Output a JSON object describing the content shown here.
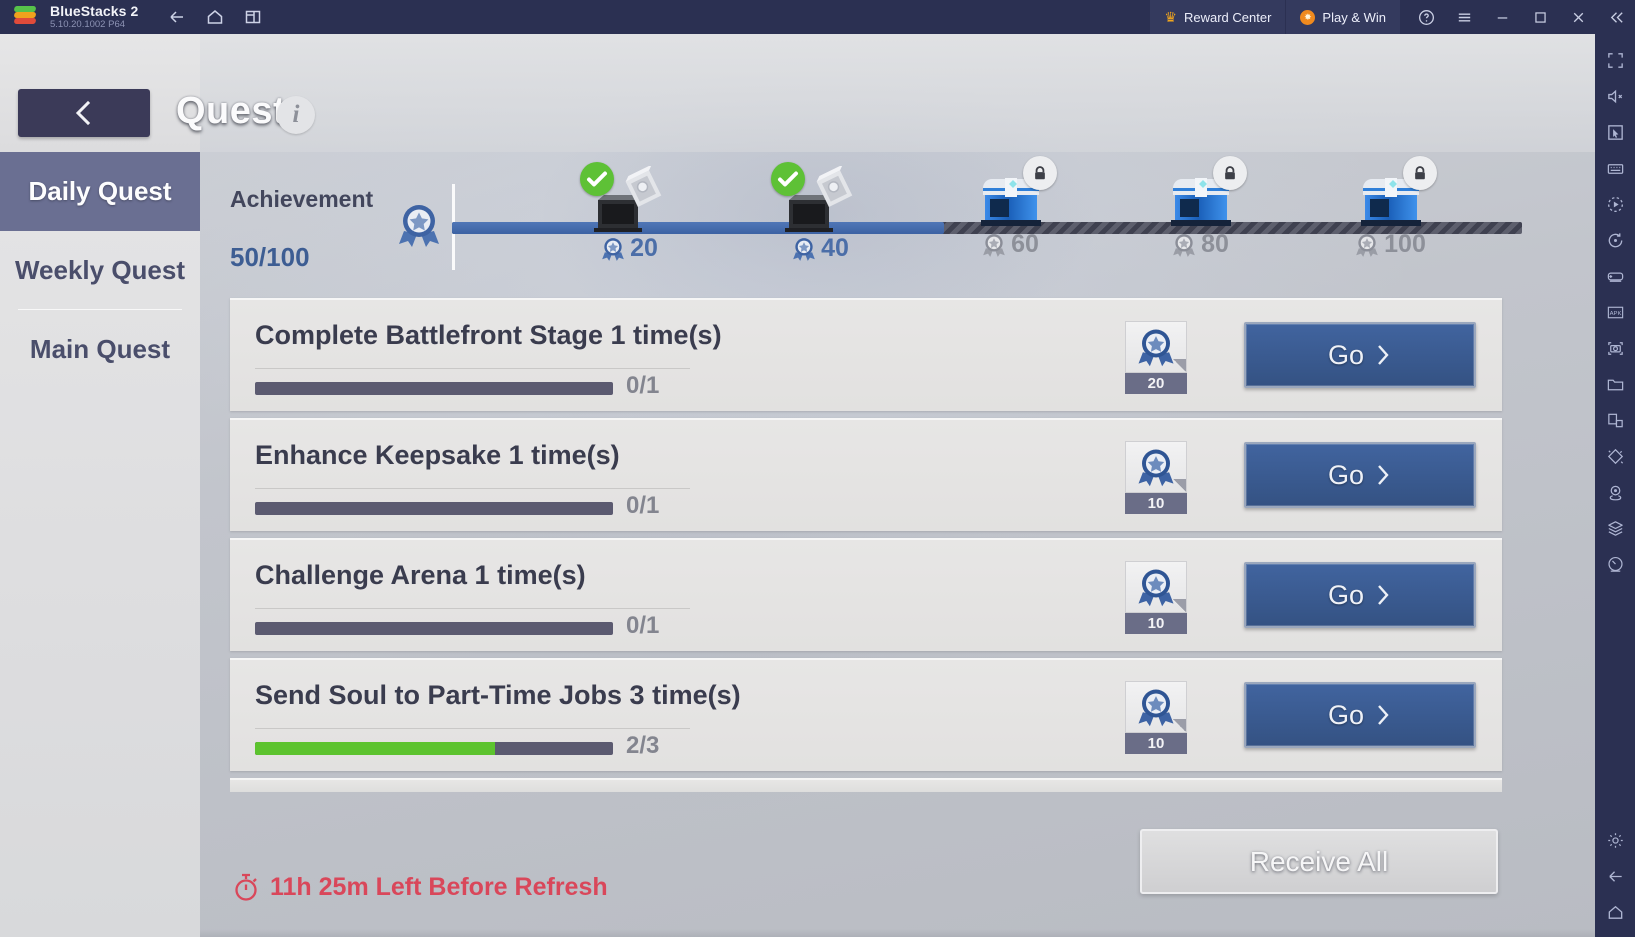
{
  "titlebar": {
    "app_name": "BlueStacks 2",
    "version": "5.10.20.1002  P64",
    "logo_icon": "bluestacks-logo",
    "nav": [
      {
        "icon": "back-arrow-icon",
        "name": "back"
      },
      {
        "icon": "home-icon",
        "name": "home"
      },
      {
        "icon": "multi-instance-icon",
        "name": "multi-instance"
      }
    ],
    "reward_center": {
      "label": "Reward Center",
      "icon": "crown-icon",
      "glyph": "♛"
    },
    "play_and_win": {
      "label": "Play & Win",
      "icon": "coin-icon",
      "glyph": "✸"
    },
    "system": [
      {
        "icon": "help-icon",
        "name": "help"
      },
      {
        "icon": "hamburger-menu-icon",
        "name": "menu"
      },
      {
        "icon": "minimize-icon",
        "name": "minimize"
      },
      {
        "icon": "maximize-icon",
        "name": "maximize"
      },
      {
        "icon": "close-icon",
        "name": "close"
      },
      {
        "icon": "collapse-chevrons-icon",
        "name": "collapse-sidebar"
      }
    ]
  },
  "right_toolbar": {
    "top_icons": [
      "fullscreen-icon",
      "mute-icon",
      "cursor-pointer-icon",
      "keyboard-icon",
      "macro-play-icon",
      "rotate-icon",
      "gamepad-icon",
      "install-apk-icon",
      "screenshot-icon",
      "folder-icon",
      "copy-instance-icon",
      "shake-icon",
      "location-icon",
      "layers-icon",
      "speedometer-icon"
    ],
    "bottom_icons": [
      "gear-icon",
      "back-arrow-icon",
      "home-icon"
    ]
  },
  "header": {
    "back_button_icon": "chevron-left-icon",
    "title": "Quest",
    "info_icon": "info-icon",
    "info_glyph": "i"
  },
  "sidebar": {
    "tabs": [
      {
        "label": "Daily Quest",
        "active": true
      },
      {
        "label": "Weekly Quest",
        "active": false
      },
      {
        "label": "Main Quest",
        "active": false
      }
    ]
  },
  "achievement": {
    "label": "Achievement",
    "value_text": "50/100",
    "current": 50,
    "max": 100,
    "medal_icon": "achievement-medal-icon",
    "milestones": [
      {
        "value": 20,
        "label": "20",
        "state": "claimed",
        "icon": "opened-chest-icon",
        "overlay": "green-check-icon"
      },
      {
        "value": 40,
        "label": "40",
        "state": "claimed",
        "icon": "opened-chest-icon",
        "overlay": "green-check-icon"
      },
      {
        "value": 60,
        "label": "60",
        "state": "locked",
        "icon": "blue-chest-icon",
        "overlay": "lock-icon"
      },
      {
        "value": 80,
        "label": "80",
        "state": "locked",
        "icon": "blue-chest-icon",
        "overlay": "lock-icon"
      },
      {
        "value": 100,
        "label": "100",
        "state": "locked",
        "icon": "blue-chest-icon",
        "overlay": "lock-icon"
      }
    ]
  },
  "quests": [
    {
      "title": "Complete Battlefront Stage 1 time(s)",
      "progress_text": "0/1",
      "current": 0,
      "goal": 1,
      "percent": 0,
      "reward_icon": "achievement-medal-icon",
      "reward_count": "20",
      "action_label": "Go",
      "action_icon": "chevron-right-icon"
    },
    {
      "title": "Enhance Keepsake 1 time(s)",
      "progress_text": "0/1",
      "current": 0,
      "goal": 1,
      "percent": 0,
      "reward_icon": "achievement-medal-icon",
      "reward_count": "10",
      "action_label": "Go",
      "action_icon": "chevron-right-icon"
    },
    {
      "title": "Challenge Arena 1 time(s)",
      "progress_text": "0/1",
      "current": 0,
      "goal": 1,
      "percent": 0,
      "reward_icon": "achievement-medal-icon",
      "reward_count": "10",
      "action_label": "Go",
      "action_icon": "chevron-right-icon"
    },
    {
      "title": "Send Soul to Part-Time Jobs 3 time(s)",
      "progress_text": "2/3",
      "current": 2,
      "goal": 3,
      "percent": 67,
      "reward_icon": "achievement-medal-icon",
      "reward_count": "10",
      "action_label": "Go",
      "action_icon": "chevron-right-icon"
    }
  ],
  "footer": {
    "timer_icon": "stopwatch-icon",
    "timer_text": "11h 25m Left Before Refresh",
    "receive_all_label": "Receive All"
  },
  "colors": {
    "titlebar_bg": "#2b3052",
    "accent_blue": "#3d5d93",
    "go_button": "#3c62a3",
    "progress_green": "#5cc32e",
    "timer_red": "#d9475a",
    "tab_active": "#6a6f92"
  }
}
